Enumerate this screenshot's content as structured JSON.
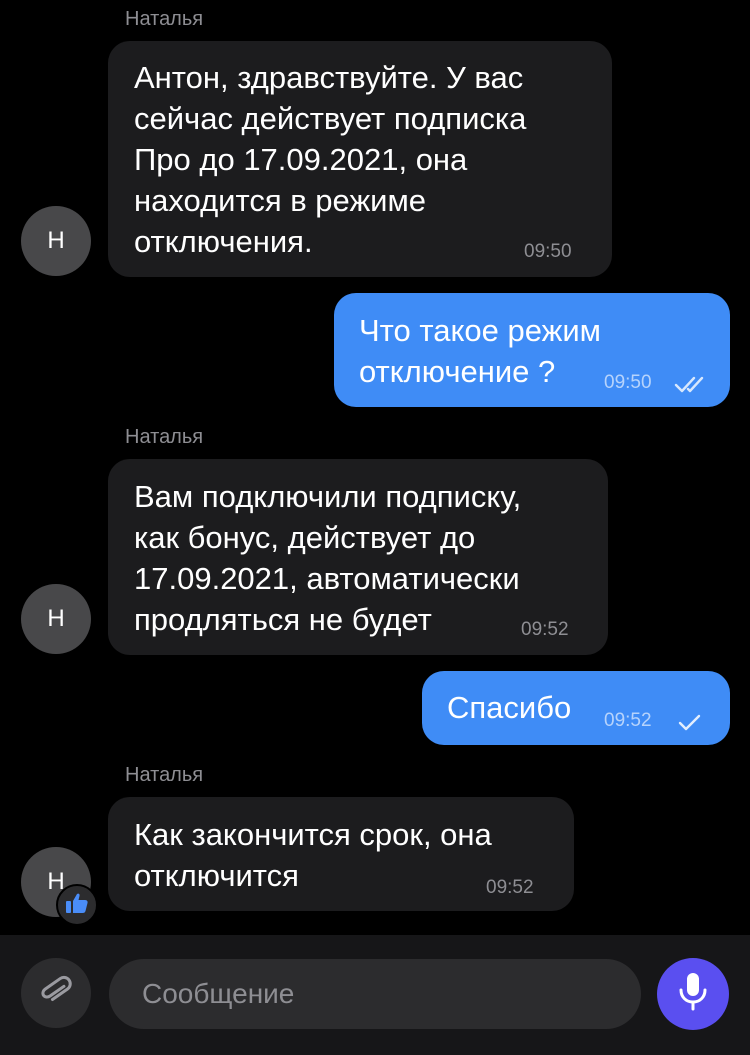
{
  "messages": [
    {
      "sender": "Наталья",
      "avatar": "Н",
      "text": "Антон, здравствуйте. У вас\nсейчас действует подписка\nПро до 17.09.2021, она\nнаходится в режиме\nотключения.",
      "time": "09:50"
    },
    {
      "text": "Что такое режим\nотключение ?",
      "time": "09:50",
      "status": "read-double-check-icon"
    },
    {
      "sender": "Наталья",
      "avatar": "Н",
      "text": "Вам подключили подписку,\nкак бонус, действует до\n17.09.2021, автоматически\nпродляться не будет",
      "time": "09:52"
    },
    {
      "text": "Спасибо",
      "time": "09:52",
      "status": "sent-check-icon"
    },
    {
      "sender": "Наталья",
      "avatar": "Н",
      "text": "Как закончится срок, она\nотключится",
      "time": "09:52",
      "reaction": "thumbs-up-icon"
    }
  ],
  "composer": {
    "placeholder": "Сообщение",
    "attach_icon": "paperclip-icon",
    "mic_icon": "microphone-icon"
  },
  "colors": {
    "background": "#000000",
    "incoming_bubble": "#1c1c1e",
    "outgoing_bubble": "#3f8cf6",
    "mic_button": "#5a4ff0",
    "reaction_blue": "#4a8df8"
  }
}
